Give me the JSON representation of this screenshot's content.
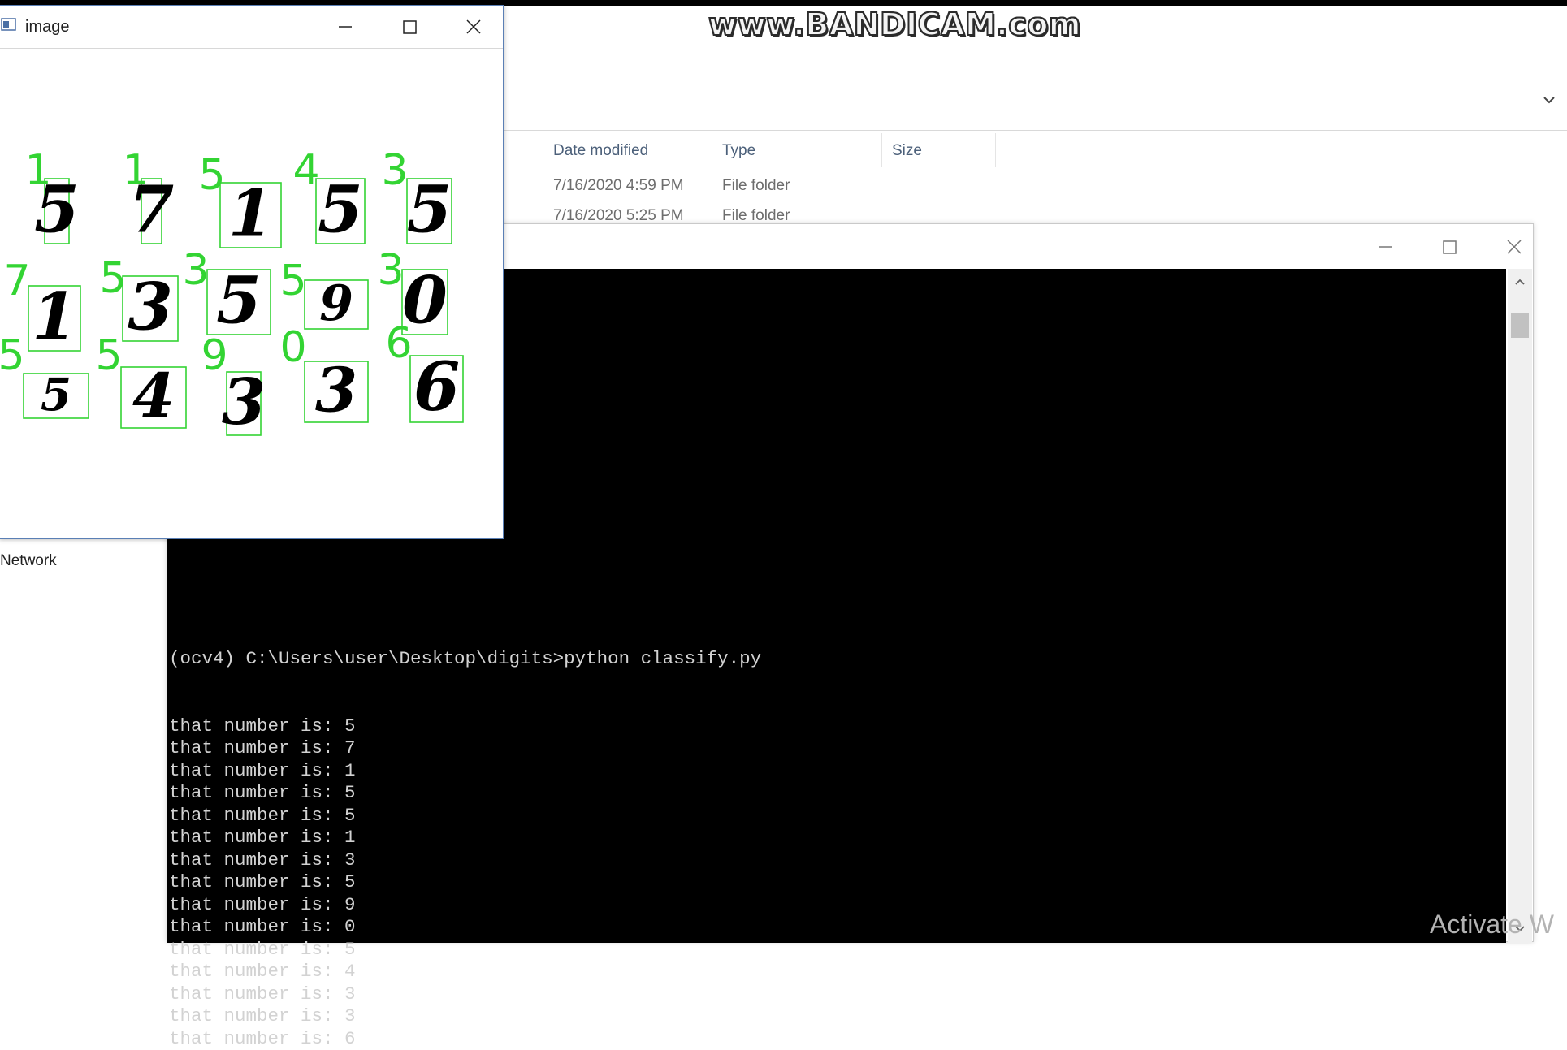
{
  "watermark": "www.BANDICAM.com",
  "explorer": {
    "columns": [
      "Date modified",
      "Type",
      "Size"
    ],
    "rows": [
      {
        "date": "7/16/2020 4:59 PM",
        "type": "File folder"
      },
      {
        "date": "7/16/2020 5:25 PM",
        "type": "File folder"
      }
    ],
    "nav": {
      "network": "Network"
    }
  },
  "image_window": {
    "title": "image",
    "predicted_labels": [
      "1",
      "1",
      "5",
      "4",
      "3",
      "7",
      "5",
      "3",
      "5",
      "3",
      "5",
      "5",
      "9",
      "0",
      "6"
    ]
  },
  "console": {
    "prompt_line": "(ocv4) C:\\Users\\user\\Desktop\\digits>python classify.py",
    "output_prefix": "that number is: ",
    "outputs": [
      "5",
      "7",
      "1",
      "5",
      "5",
      "1",
      "3",
      "5",
      "9",
      "0",
      "5",
      "4",
      "3",
      "3",
      "6"
    ]
  },
  "activation_notice": "Activate W",
  "colors": {
    "label_green": "#33d433",
    "console_bg": "#000000",
    "console_text": "#d2d2d2",
    "window_border": "#5a7fb5"
  }
}
